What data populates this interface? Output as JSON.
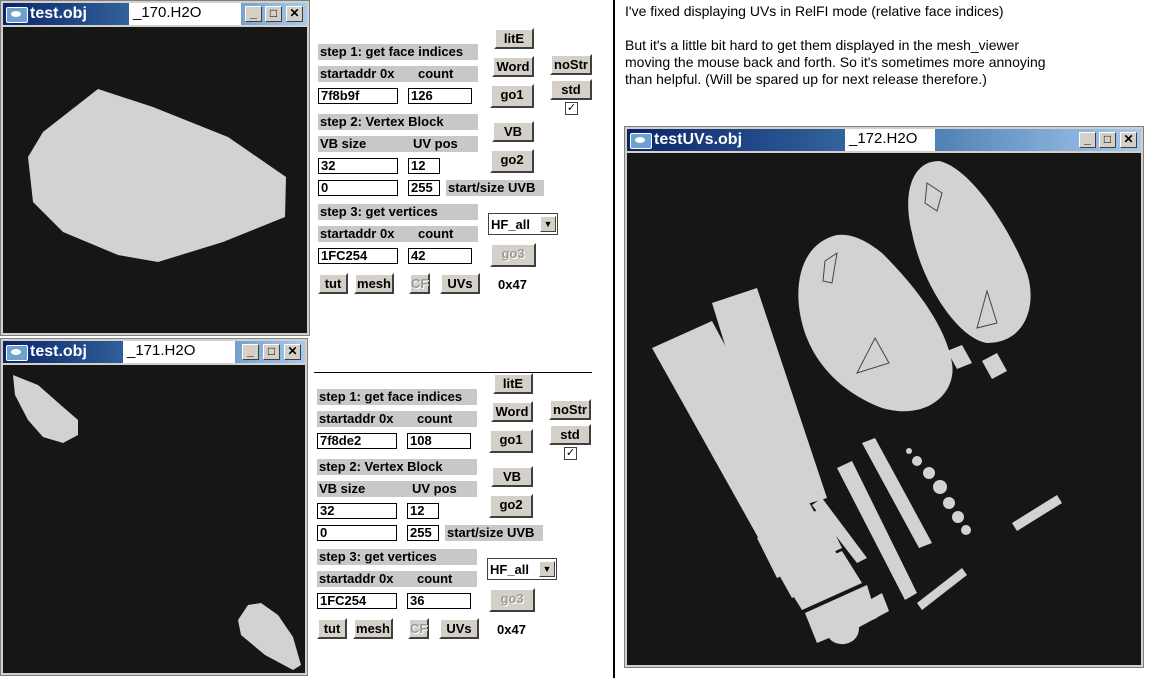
{
  "windows": {
    "w1": {
      "title": "test.obj",
      "tag": "_170.H2O"
    },
    "w2": {
      "title": "test.obj",
      "tag": "_171.H2O"
    },
    "w3": {
      "title": "testUVs.obj",
      "tag": "_172.H2O"
    },
    "buttons": {
      "min": "_",
      "max": "□",
      "close": "✕"
    }
  },
  "panel1": {
    "step1": "step 1: get face indices",
    "startaddr": "startaddr 0x",
    "count_label": "count",
    "face_addr": "7f8b9f",
    "face_count": "126",
    "step2": "step 2: Vertex Block",
    "vbsize_label": "VB size",
    "uvpos_label": "UV pos",
    "vbsize": "32",
    "uvpos": "12",
    "uvb_start": "0",
    "uvb_size": "255",
    "startsize_label": "start/size UVB",
    "step3": "step 3: get vertices",
    "vert_addr": "1FC254",
    "vert_count": "42",
    "litE": "litE",
    "word": "Word",
    "nostr": "noStr",
    "std": "std",
    "go1": "go1",
    "vb": "VB",
    "go2": "go2",
    "go3": "go3",
    "select": "HF_all",
    "tut": "tut",
    "mesh": "mesh",
    "cf": "CF",
    "uvs": "UVs",
    "hex": "0x47",
    "check": "✓"
  },
  "panel2": {
    "step1": "step 1: get face indices",
    "startaddr": "startaddr 0x",
    "count_label": "count",
    "face_addr": "7f8de2",
    "face_count": "108",
    "step2": "step 2: Vertex Block",
    "vbsize_label": "VB size",
    "uvpos_label": "UV pos",
    "vbsize": "32",
    "uvpos": "12",
    "uvb_start": "0",
    "uvb_size": "255",
    "startsize_label": "start/size UVB",
    "step3": "step 3: get vertices",
    "vert_addr": "1FC254",
    "vert_count": "36",
    "litE": "litE",
    "word": "Word",
    "nostr": "noStr",
    "std": "std",
    "go1": "go1",
    "vb": "VB",
    "go2": "go2",
    "go3": "go3",
    "select": "HF_all",
    "tut": "tut",
    "mesh": "mesh",
    "cf": "CF",
    "uvs": "UVs",
    "hex": "0x47",
    "check": "✓"
  },
  "text": {
    "line1": "I've fixed displaying UVs in RelFI mode (relative face indices)",
    "line2": "But it's a little bit hard to get them displayed in the mesh_viewer",
    "line3": "moving the mouse back and forth. So it's sometimes more annoying",
    "line4": "than helpful. (Will be spared up for next release therefore.)"
  },
  "colors": {
    "titlebar": "#0a246a",
    "viewport": "#161616",
    "mesh": "#d2d2d0"
  }
}
